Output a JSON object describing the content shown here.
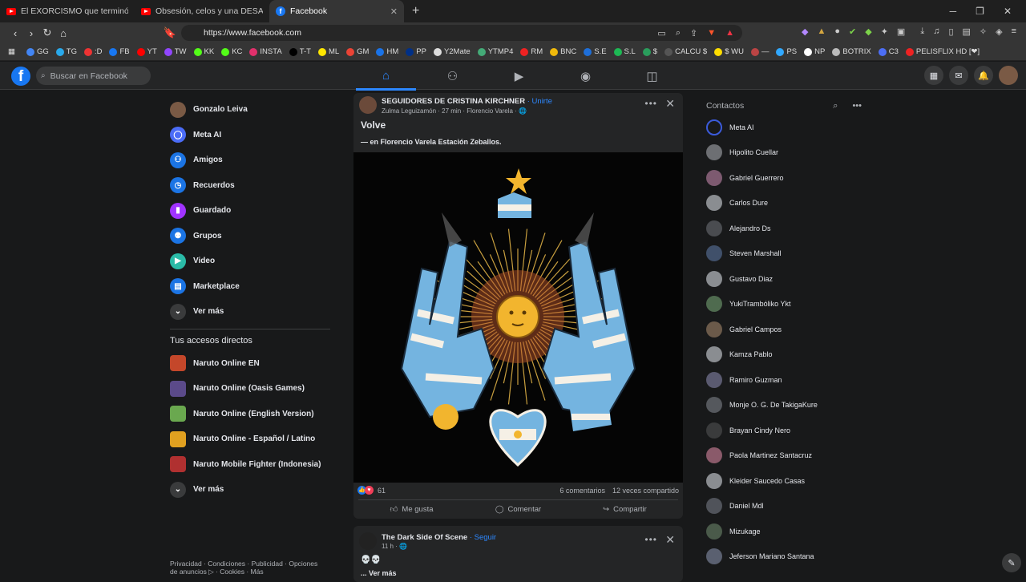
{
  "browser": {
    "tabs": [
      {
        "title": "El EXORCISMO que terminó en un",
        "icon": "youtube-icon"
      },
      {
        "title": "Obsesión, celos y una DESAPARICIÓN",
        "icon": "youtube-icon"
      },
      {
        "title": "Facebook",
        "icon": "facebook-icon",
        "active": true
      }
    ],
    "url": "https://www.facebook.com",
    "bookmarks": [
      {
        "label": "GG",
        "color": "#4285f4"
      },
      {
        "label": "TG",
        "color": "#29a9eb"
      },
      {
        "label": ":D",
        "color": "#e33"
      },
      {
        "label": "FB",
        "color": "#1877f2"
      },
      {
        "label": "YT",
        "color": "#f00"
      },
      {
        "label": "TW",
        "color": "#9146ff"
      },
      {
        "label": "KK",
        "color": "#53fc18"
      },
      {
        "label": "KC",
        "color": "#53fc18"
      },
      {
        "label": "INSTA",
        "color": "#e1306c"
      },
      {
        "label": "T-T",
        "color": "#000"
      },
      {
        "label": "ML",
        "color": "#ffe600"
      },
      {
        "label": "GM",
        "color": "#ea4335"
      },
      {
        "label": "HM",
        "color": "#1a73e8"
      },
      {
        "label": "PP",
        "color": "#003087"
      },
      {
        "label": "Y2Mate",
        "color": "#ddd"
      },
      {
        "label": "YTMP4",
        "color": "#4a7"
      },
      {
        "label": "RM",
        "color": "#e22"
      },
      {
        "label": "BNC",
        "color": "#f0b90b"
      },
      {
        "label": "S.E",
        "color": "#1e6fd9"
      },
      {
        "label": "S.L",
        "color": "#1db954"
      },
      {
        "label": "$",
        "color": "#2a9d5c"
      },
      {
        "label": "CALCU $",
        "color": "#555"
      },
      {
        "label": "$ WU",
        "color": "#ffdd00"
      },
      {
        "label": "—",
        "color": "#b44"
      },
      {
        "label": "PS",
        "color": "#31a8ff"
      },
      {
        "label": "NP",
        "color": "#fff"
      },
      {
        "label": "BOTRIX",
        "color": "#bbb"
      },
      {
        "label": "C3",
        "color": "#4c6ef5"
      },
      {
        "label": "PELISFLIX HD [❤]",
        "color": "#e22"
      }
    ]
  },
  "header": {
    "logo": "f",
    "search_placeholder": "Buscar en Facebook"
  },
  "left_menu": [
    {
      "label": "Gonzalo Leiva",
      "icon": "avatar",
      "color": "#7a5a45"
    },
    {
      "label": "Meta AI",
      "icon": "meta-ai-icon",
      "color": "#4b6cf7"
    },
    {
      "label": "Amigos",
      "icon": "friends-icon",
      "color": "#1b74e4"
    },
    {
      "label": "Recuerdos",
      "icon": "clock-icon",
      "color": "#1b74e4"
    },
    {
      "label": "Guardado",
      "icon": "bookmark-icon",
      "color": "#a033ff"
    },
    {
      "label": "Grupos",
      "icon": "groups-icon",
      "color": "#1b74e4"
    },
    {
      "label": "Video",
      "icon": "video-icon",
      "color": "#2abba7"
    },
    {
      "label": "Marketplace",
      "icon": "marketplace-icon",
      "color": "#1b74e4"
    },
    {
      "label": "Ver más",
      "icon": "chevron-down-icon",
      "color": "#3a3b3c"
    }
  ],
  "shortcuts": {
    "title": "Tus accesos directos",
    "items": [
      {
        "label": "Naruto Online EN",
        "color": "#c4472a"
      },
      {
        "label": "Naruto Online (Oasis Games)",
        "color": "#5b4a8a"
      },
      {
        "label": "Naruto Online (English Version)",
        "color": "#6aa84f"
      },
      {
        "label": "Naruto Online - Español / Latino",
        "color": "#e0a020"
      },
      {
        "label": "Naruto Mobile Fighter (Indonesia)",
        "color": "#b03030"
      },
      {
        "label": "Ver más",
        "color": "#3a3b3c"
      }
    ]
  },
  "footer": "Privacidad · Condiciones · Publicidad · Opciones de anuncios ▷ · Cookies · Más",
  "post": {
    "group": "SEGUIDORES DE CRISTINA KIRCHNER",
    "join": "· Unirte",
    "meta": "Zulma Leguizamón · 27 min · Florencio Varela · 🌐",
    "title": "Volve",
    "location": "— en Florencio Varela Estación Zeballos.",
    "reactions": "61",
    "comments": "6 comentarios",
    "shares": "12 veces compartido",
    "like": "Me gusta",
    "comment": "Comentar",
    "share": "Compartir"
  },
  "post2": {
    "page": "The Dark Side Of Scene",
    "follow": "· Seguir",
    "meta": "11 h · 🌐",
    "text": "💀💀",
    "more": "... Ver más"
  },
  "contacts": {
    "title": "Contactos",
    "items": [
      {
        "name": "Meta AI",
        "color": "#3b5bdb"
      },
      {
        "name": "Hipolito Cuellar",
        "color": "#6d6f73"
      },
      {
        "name": "Gabriel Guerrero",
        "color": "#7d5a70"
      },
      {
        "name": "Carlos Dure",
        "color": "#8a8d91"
      },
      {
        "name": "Alejandro Ds",
        "color": "#4a4c50"
      },
      {
        "name": "Steven Marshall",
        "color": "#40506a"
      },
      {
        "name": "Gustavo Diaz",
        "color": "#8a8d91"
      },
      {
        "name": "YukiTrambóliko Ykt",
        "color": "#4f6b4f"
      },
      {
        "name": "Gabriel Campos",
        "color": "#6b5a4a"
      },
      {
        "name": "Kamza Pablo",
        "color": "#8a8d91"
      },
      {
        "name": "Ramiro Guzman",
        "color": "#5a5a70"
      },
      {
        "name": "Monje O. G. De TakigaKure",
        "color": "#55585d"
      },
      {
        "name": "Brayan Cindy Nero",
        "color": "#3a3b3c"
      },
      {
        "name": "Paola Martinez Santacruz",
        "color": "#8a5a6a"
      },
      {
        "name": "Kleider Saucedo Casas",
        "color": "#8a8d91"
      },
      {
        "name": "Daniel Mdl",
        "color": "#50535a"
      },
      {
        "name": "Mizukage",
        "color": "#4a5a4a"
      },
      {
        "name": "Jeferson Mariano Santana",
        "color": "#5a6070"
      }
    ]
  }
}
